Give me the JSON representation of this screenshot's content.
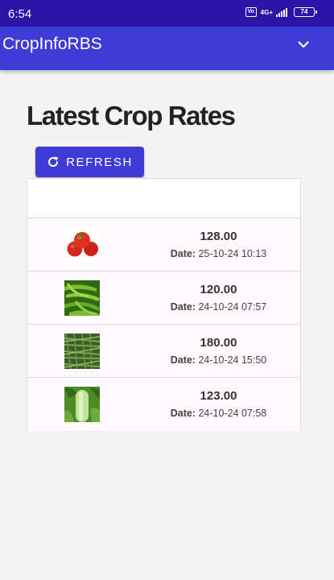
{
  "status_bar": {
    "time": "6:54",
    "sim_label": "VoLTE",
    "network": "4G+",
    "battery": "74"
  },
  "app_bar": {
    "title": "CropInfoRBS",
    "menu_icon": "chevron-down-icon"
  },
  "page": {
    "title": "Latest Crop Rates",
    "refresh_label": "REFRESH",
    "refresh_icon": "refresh-icon"
  },
  "rates": [
    {
      "crop_icon": "tomato-image",
      "price": "128.00",
      "date_label": "Date:",
      "date": "25-10-24 10:13"
    },
    {
      "crop_icon": "green-chilli-image",
      "price": "120.00",
      "date_label": "Date:",
      "date": "24-10-24 07:57"
    },
    {
      "crop_icon": "cluster-beans-image",
      "price": "180.00",
      "date_label": "Date:",
      "date": "24-10-24 15:50"
    },
    {
      "crop_icon": "bottle-gourd-image",
      "price": "123.00",
      "date_label": "Date:",
      "date": "24-10-24 07:58"
    }
  ],
  "colors": {
    "status_bar": "#2c13a8",
    "primary": "#3f3bd6",
    "background": "#f4f4f4",
    "row_background": "#fdf9fd"
  }
}
